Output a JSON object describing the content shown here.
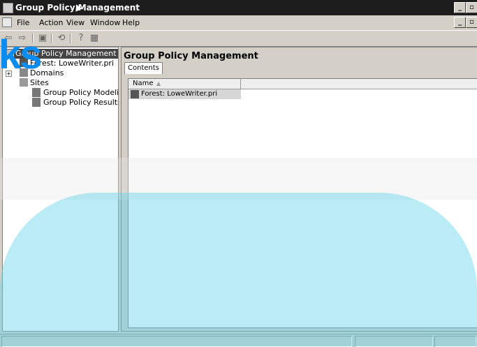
{
  "window": {
    "title": "Group Policy Management"
  },
  "menu": {
    "items": [
      "File",
      "Action",
      "View",
      "Window",
      "Help"
    ]
  },
  "toolbar": {
    "buttons": [
      "back-icon",
      "forward-icon",
      "up-icon",
      "refresh-icon",
      "help-icon",
      "properties-icon"
    ]
  },
  "tree": {
    "root": "Group Policy Management",
    "forest": "Forest: LoweWriter.pri",
    "domains": "Domains",
    "sites": "Sites",
    "modeling": "Group Policy Modeling",
    "results": "Group Policy Results"
  },
  "pane": {
    "title": "Group Policy Management",
    "tab": "Contents"
  },
  "list": {
    "column": "Name",
    "sort_indicator": "▲",
    "rows": [
      "Forest: LoweWriter.pri"
    ]
  },
  "watermark": {
    "brand": "ks"
  },
  "colors": {
    "title_bg": "#1d1d1d",
    "watermark": "#66d4e8",
    "brand": "#0a8cf0"
  }
}
